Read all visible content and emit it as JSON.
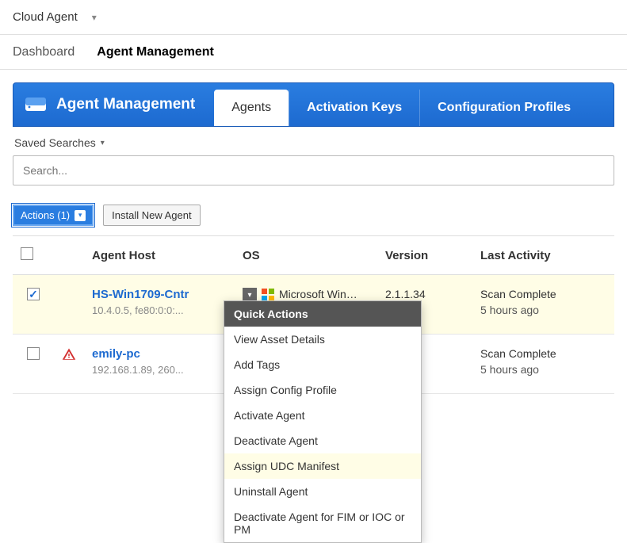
{
  "app": {
    "title": "Cloud Agent"
  },
  "nav": {
    "dashboard": "Dashboard",
    "agent_mgmt": "Agent Management"
  },
  "header": {
    "title": "Agent Management"
  },
  "tabs": {
    "agents": "Agents",
    "activation_keys": "Activation Keys",
    "config_profiles": "Configuration Profiles"
  },
  "toolbar": {
    "saved_searches": "Saved Searches",
    "search_placeholder": "Search..."
  },
  "actions": {
    "actions_btn": "Actions (1)",
    "install_btn": "Install New Agent"
  },
  "columns": {
    "host": "Agent Host",
    "os": "OS",
    "version": "Version",
    "activity": "Last Activity"
  },
  "rows": [
    {
      "selected": true,
      "host": "HS-Win1709-Cntr",
      "host_sub": "10.4.0.5, fe80:0:0:...",
      "os": "Microsoft Win…",
      "version": "2.1.1.34",
      "activity": "Scan Complete",
      "activity_sub": "5 hours ago",
      "warn": false
    },
    {
      "selected": false,
      "host": "emily-pc",
      "host_sub": "192.168.1.89, 260...",
      "os": "",
      "version": "",
      "activity": "Scan Complete",
      "activity_sub": "5 hours ago",
      "warn": true
    }
  ],
  "dropdown": {
    "header": "Quick Actions",
    "items": [
      "View Asset Details",
      "Add Tags",
      "Assign Config Profile",
      "Activate Agent",
      "Deactivate Agent",
      "Assign UDC Manifest",
      "Uninstall Agent",
      "Deactivate Agent for FIM or IOC or PM"
    ],
    "highlighted_index": 5
  }
}
